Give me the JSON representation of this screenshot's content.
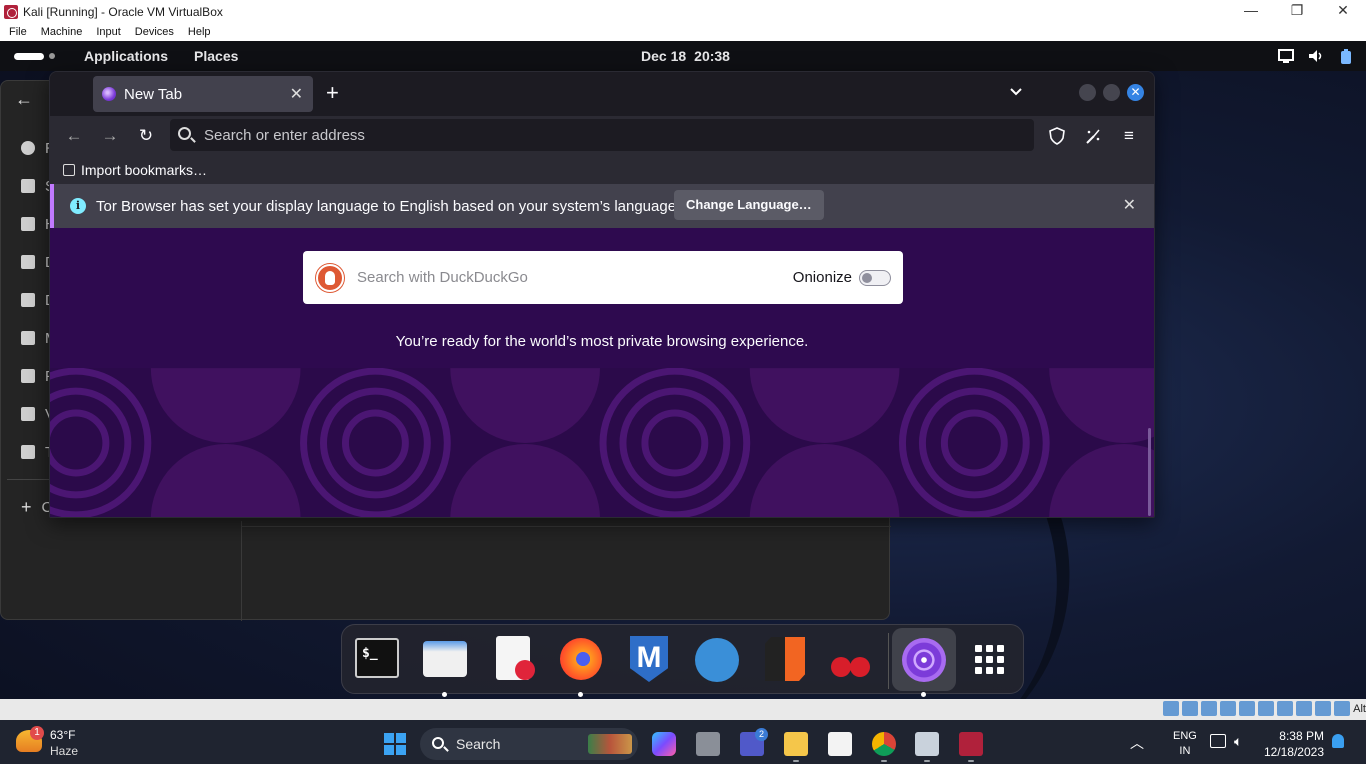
{
  "host_window": {
    "title": "Kali [Running] - Oracle VM VirtualBox",
    "controls": {
      "minimize": "—",
      "restore": "❐",
      "close": "✕"
    },
    "menu": [
      "File",
      "Machine",
      "Input",
      "Devices",
      "Help"
    ]
  },
  "gnome_topbar": {
    "applications_label": "Applications",
    "places_label": "Places",
    "date": "Dec 18",
    "time": "20:38"
  },
  "files_sidebar": {
    "items": [
      {
        "label": "R",
        "icon": "recent-icon"
      },
      {
        "label": "S",
        "icon": "star-icon"
      },
      {
        "label": "H",
        "icon": "home-icon"
      },
      {
        "label": "D",
        "icon": "document-icon"
      },
      {
        "label": "D",
        "icon": "download-icon"
      },
      {
        "label": "M",
        "icon": "music-icon"
      },
      {
        "label": "P",
        "icon": "picture-icon"
      },
      {
        "label": "V",
        "icon": "video-icon"
      },
      {
        "label": "T",
        "icon": "trash-icon"
      }
    ],
    "other_label": "C"
  },
  "tor_browser": {
    "tab_title": "New Tab",
    "address_placeholder": "Search or enter address",
    "import_bookmarks_label": "Import bookmarks…",
    "notice_text": "Tor Browser has set your display language to English based on your system’s language.",
    "change_language_label": "Change Language…",
    "search_placeholder": "Search with DuckDuckGo",
    "onionize_label": "Onionize",
    "onionize_enabled": false,
    "tagline": "You’re ready for the world’s most private browsing experience.",
    "colors": {
      "page_bg": "#2e0a4f",
      "pattern": "#4b1673",
      "accent": "#c17aff"
    }
  },
  "dock": {
    "apps": [
      {
        "name": "terminal",
        "running": false
      },
      {
        "name": "files",
        "running": true
      },
      {
        "name": "text-editor",
        "running": false
      },
      {
        "name": "firefox",
        "running": true
      },
      {
        "name": "metasploit",
        "running": false
      },
      {
        "name": "wireshark",
        "running": false
      },
      {
        "name": "burp-suite",
        "running": false
      },
      {
        "name": "cherrytree",
        "running": false
      },
      {
        "name": "tor-browser",
        "running": true
      },
      {
        "name": "show-apps",
        "running": false
      }
    ],
    "terminal_glyph": "$_"
  },
  "vbox_status": {
    "host_key_label": "Alt"
  },
  "win_taskbar": {
    "weather": {
      "temp": "63°F",
      "condition": "Haze",
      "badge": "1"
    },
    "search_label": "Search",
    "teams_badge": "2",
    "lang_line1": "ENG",
    "lang_line2": "IN",
    "clock_time": "8:38 PM",
    "clock_date": "12/18/2023"
  }
}
